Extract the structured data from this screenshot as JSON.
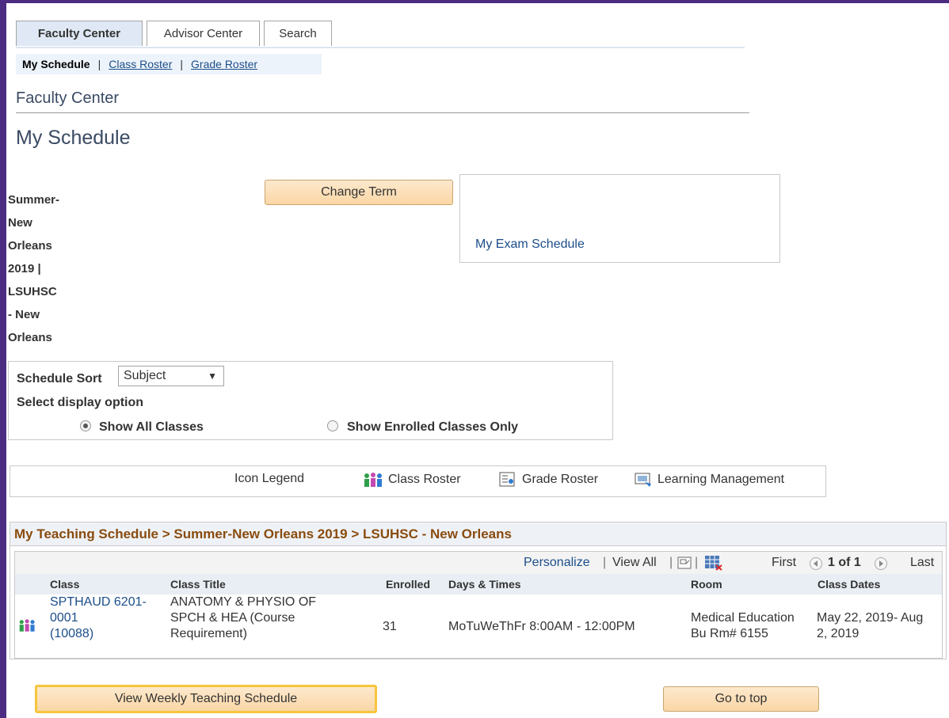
{
  "tabs": [
    {
      "label": "Faculty Center",
      "active": true
    },
    {
      "label": "Advisor Center",
      "active": false
    },
    {
      "label": "Search",
      "active": false
    }
  ],
  "subnav": {
    "current": "My Schedule",
    "link1": "Class Roster",
    "link2": "Grade Roster",
    "sep": "|"
  },
  "section_title": "Faculty Center",
  "page_title": "My Schedule",
  "term_lines": [
    "Summer-",
    "New",
    "Orleans",
    "2019 |",
    "LSUHSC",
    "- New",
    "Orleans"
  ],
  "change_term_label": "Change Term",
  "exam_link": "My Exam Schedule",
  "sort": {
    "label": "Schedule Sort",
    "selected": "Subject"
  },
  "display": {
    "label": "Select display option",
    "option_all": "Show All Classes",
    "option_enrolled": "Show Enrolled Classes Only",
    "selected": "all"
  },
  "legend": {
    "title": "Icon Legend",
    "class_roster": "Class Roster",
    "grade_roster": "Grade Roster",
    "lms": "Learning Management"
  },
  "schedule": {
    "header": "My Teaching Schedule > Summer-New Orleans 2019 > LSUHSC - New Orleans",
    "nav": {
      "personalize": "Personalize",
      "sep": "|",
      "view_all": "View All",
      "first": "First",
      "count": "1 of 1",
      "last": "Last"
    },
    "columns": [
      "Class",
      "Class Title",
      "Enrolled",
      "Days & Times",
      "Room",
      "Class Dates"
    ],
    "rows": [
      {
        "class": [
          "SPTHAUD 6201-",
          "0001",
          "(10088)"
        ],
        "title": [
          "ANATOMY & PHYSIO OF",
          "SPCH & HEA (Course",
          "Requirement)"
        ],
        "enrolled": "31",
        "days": "MoTuWeThFr 8:00AM - 12:00PM",
        "room": [
          "Medical Education",
          "Bu Rm# 6155"
        ],
        "dates": [
          "May 22, 2019- Aug",
          "2, 2019"
        ]
      }
    ]
  },
  "weekly_button": "View Weekly Teaching Schedule",
  "top_button": "Go to top",
  "colors": {
    "frame": "#4b2c82",
    "header_text": "#8a4b0f",
    "link": "#1c4e8a",
    "focus": "#f5c63c"
  }
}
